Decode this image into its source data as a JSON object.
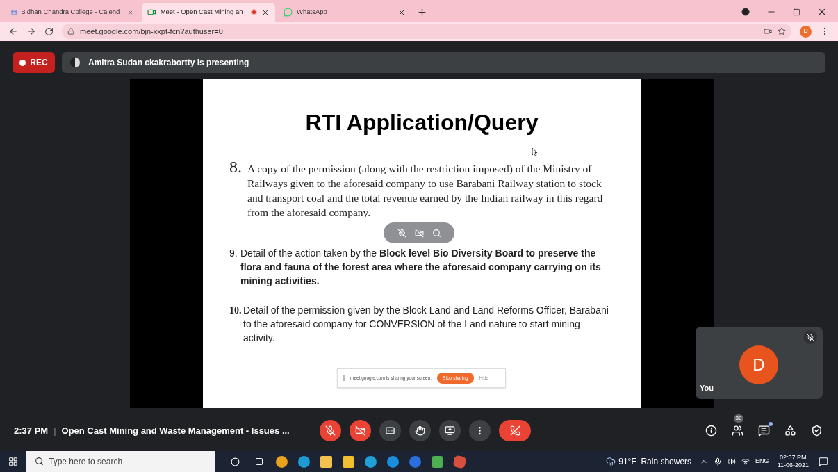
{
  "browser": {
    "tabs": [
      {
        "title": "Bidhan Chandra College - Calend",
        "kind": "calendar",
        "selected": false,
        "recording": false
      },
      {
        "title": "Meet - Open Cast Mining an",
        "kind": "meet",
        "selected": true,
        "recording": true
      },
      {
        "title": "WhatsApp",
        "kind": "whatsapp",
        "selected": false,
        "recording": false
      }
    ],
    "url": "meet.google.com/bjn-xxpt-fcn?authuser=0",
    "profile": "D"
  },
  "meet": {
    "rec_label": "REC",
    "presenting": "Amitra Sudan ckakrabortty is presenting",
    "slide": {
      "title": "RTI Application/Query",
      "items": [
        {
          "number": "8.",
          "kind": "serif",
          "text": "A copy of the permission (along with the restriction imposed) of the Ministry of Railways given to the aforesaid company to use Barabani Railway station to stock and transport coal and the total revenue earned by the Indian railway in this regard from the aforesaid company."
        },
        {
          "number": "9.",
          "kind": "sans",
          "text": "Detail of the action taken by the **Block level Bio Diversity Board to preserve the flora and fauna of the forest area where the aforesaid company carrying on its mining activities.**"
        },
        {
          "number": "10.",
          "kind": "bold-number",
          "text": "Detail of the permission given by the Block Land and Land Reforms Officer, Barabani to the aforesaid company for CONVERSION of the Land nature to start mining activity."
        }
      ]
    },
    "share_banner": {
      "message": "meet.google.com is sharing your screen.",
      "stop": "Stop sharing",
      "hide": "Hide"
    },
    "self_tile": {
      "initial": "D",
      "label": "You",
      "muted": true
    },
    "time": "2:37 PM",
    "separator": "|",
    "meeting_title": "Open Cast Mining and Waste Management - Issues ...",
    "controls": [
      {
        "kind": "mic",
        "off": true
      },
      {
        "kind": "camera",
        "off": true
      },
      {
        "kind": "captions",
        "off": false
      },
      {
        "kind": "hand",
        "off": false
      },
      {
        "kind": "present",
        "off": false
      },
      {
        "kind": "more",
        "off": false
      },
      {
        "kind": "hangup"
      }
    ],
    "side_controls": [
      {
        "kind": "info"
      },
      {
        "kind": "people",
        "badge": "38"
      },
      {
        "kind": "chat",
        "dot": true
      },
      {
        "kind": "activities"
      },
      {
        "kind": "security"
      }
    ]
  },
  "taskbar": {
    "search_placeholder": "Type here to search",
    "apps": [
      {
        "kind": "chrome",
        "color": "#e8a21c"
      },
      {
        "kind": "edge-beta",
        "color": "#1e9bd7"
      },
      {
        "kind": "files",
        "color": "#f2c14e"
      },
      {
        "kind": "store",
        "color": "#f0c030"
      },
      {
        "kind": "edge",
        "color": "#1fa0d8"
      },
      {
        "kind": "skype",
        "color": "#1a8fe0"
      },
      {
        "kind": "sigma",
        "color": "#2a6fdb"
      },
      {
        "kind": "camera",
        "color": "#4caf50"
      },
      {
        "kind": "paint",
        "color": "#d94f3d"
      }
    ],
    "weather": "91°F  Rain showers",
    "language": "ENG",
    "clock_time": "02:37 PM",
    "clock_date": "11-06-2021"
  }
}
